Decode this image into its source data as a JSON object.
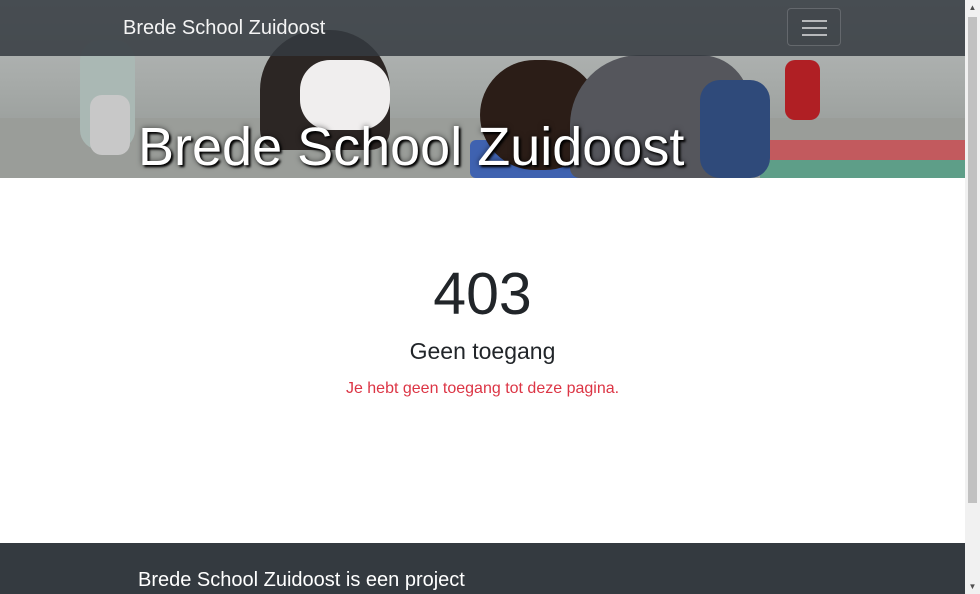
{
  "navbar": {
    "brand": "Brede School Zuidoost",
    "menu_icon": "hamburger-menu-icon"
  },
  "hero": {
    "title": "Brede School Zuidoost"
  },
  "error": {
    "code": "403",
    "title": "Geen toegang",
    "message": "Je hebt geen toegang tot deze pagina."
  },
  "footer": {
    "text": "Brede School Zuidoost is een project"
  },
  "colors": {
    "navbar_bg": "#343a40",
    "footer_bg": "#343a40",
    "error_message": "#dc3545",
    "text_dark": "#212529"
  }
}
